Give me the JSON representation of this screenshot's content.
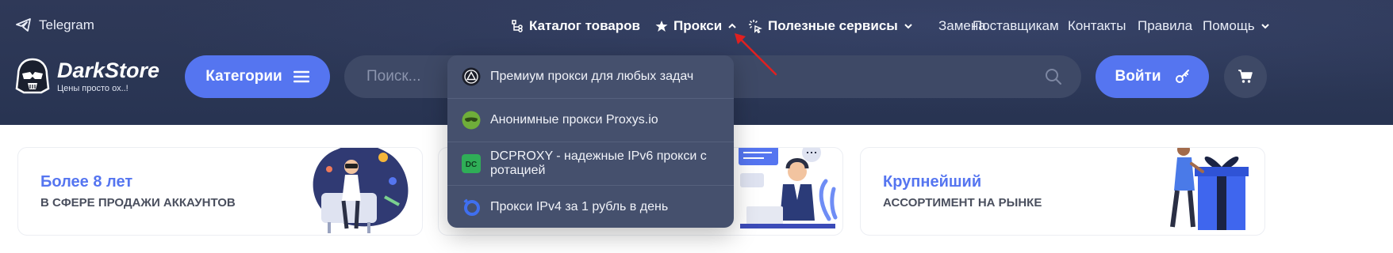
{
  "topbar": {
    "telegram_label": "Telegram"
  },
  "nav": {
    "catalog": "Каталог товаров",
    "proxy": "Прокси",
    "services": "Полезные сервисы",
    "replace": "Замена",
    "suppliers": "Поставщикам",
    "contacts": "Контакты",
    "rules": "Правила",
    "help": "Помощь"
  },
  "logo": {
    "title": "DarkStore",
    "subtitle": "Цены просто ох..!"
  },
  "header": {
    "categories_label": "Категории",
    "search_placeholder": "Поиск...",
    "login_label": "Войти"
  },
  "proxy_menu": {
    "items": [
      {
        "label": "Премиум прокси для любых задач",
        "icon": "triangle-logo-icon"
      },
      {
        "label": "Анонимные прокси Proxys.io",
        "icon": "mask-logo-icon"
      },
      {
        "label": "DCPROXY - надежные IPv6 прокси с ротацией",
        "icon": "dc-logo-icon"
      },
      {
        "label": "Прокси IPv4 за 1 рубль в день",
        "icon": "ring-logo-icon"
      }
    ]
  },
  "cards": [
    {
      "title": "Более 8 лет",
      "subtitle": "В СФЕРЕ ПРОДАЖИ АККАУНТОВ"
    },
    {
      "title": "",
      "subtitle": ""
    },
    {
      "title": "Крупнейший",
      "subtitle": "АССОРТИМЕНТ НА РЫНКЕ"
    }
  ],
  "colors": {
    "header_bg": "#2d3756",
    "accent": "#5575f0",
    "dropdown_bg": "#45506d",
    "annotation_arrow": "#e02020"
  }
}
